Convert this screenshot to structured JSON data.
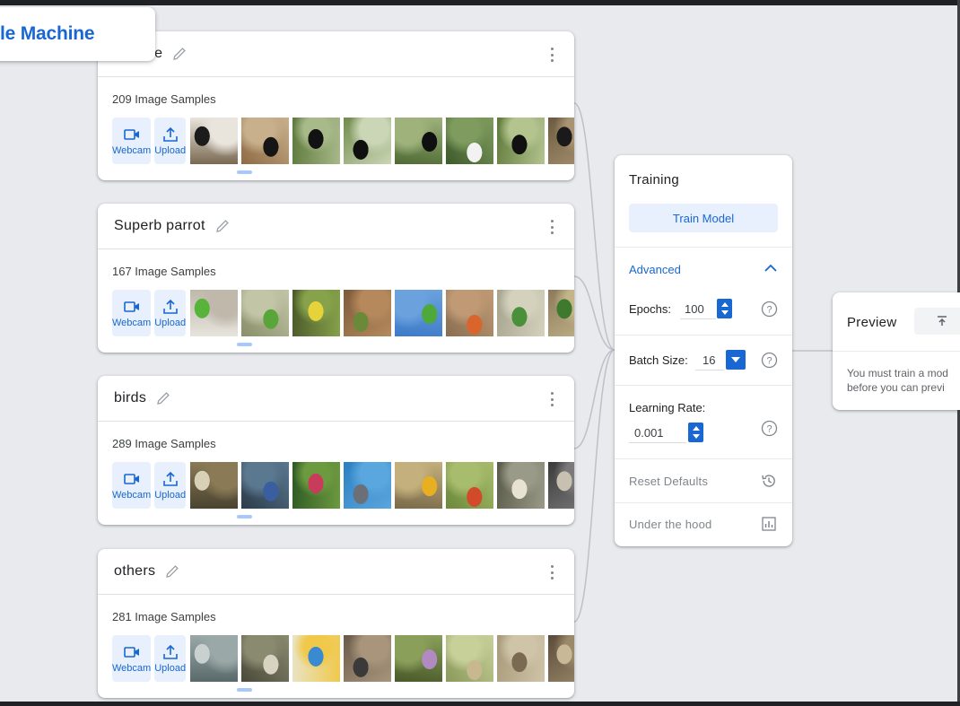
{
  "app": {
    "title_fragment": "le Machine"
  },
  "classes": [
    {
      "name": "Magpie",
      "sample_count": "209 Image Samples",
      "webcam_label": "Webcam",
      "upload_label": "Upload",
      "thumb_palettes": [
        [
          "#7a6a52",
          "#e9e4dc",
          "#1b1b1b"
        ],
        [
          "#8f6b45",
          "#c9b08d",
          "#151515"
        ],
        [
          "#5e7a3d",
          "#a8b98a",
          "#121212"
        ],
        [
          "#6f8a4a",
          "#cbd6b6",
          "#0f0f0f"
        ],
        [
          "#4f6b34",
          "#9fb27c",
          "#101010"
        ],
        [
          "#3d5a2b",
          "#7f9c5e",
          "#f2f2f2"
        ],
        [
          "#5f7a3a",
          "#b4c48f",
          "#111111"
        ],
        [
          "#6b5a3e",
          "#a89372",
          "#1a1a1a"
        ]
      ]
    },
    {
      "name": "Superb parrot",
      "sample_count": "167 Image Samples",
      "webcam_label": "Webcam",
      "upload_label": "Upload",
      "thumb_palettes": [
        [
          "#e6e3dc",
          "#bfb8ab",
          "#58b33a"
        ],
        [
          "#8a8f6a",
          "#c2c6a7",
          "#5aa53a"
        ],
        [
          "#4b5a2a",
          "#86a24a",
          "#e6d23a"
        ],
        [
          "#7c5a3a",
          "#b5895c",
          "#6a8a3a"
        ],
        [
          "#3e7bc8",
          "#6ba2de",
          "#4fa83a"
        ],
        [
          "#8a6e52",
          "#c09a74",
          "#d9652d"
        ],
        [
          "#a7a48e",
          "#d4d1bd",
          "#4a8f3a"
        ],
        [
          "#8a7a5a",
          "#c4b48a",
          "#3d7a2e"
        ]
      ]
    },
    {
      "name": "birds",
      "sample_count": "289 Image Samples",
      "webcam_label": "Webcam",
      "upload_label": "Upload",
      "thumb_palettes": [
        [
          "#4a4330",
          "#8a7a55",
          "#d9d0b8"
        ],
        [
          "#2c3c4a",
          "#5a7890",
          "#3a5fa0"
        ],
        [
          "#2f5a24",
          "#6c9a3f",
          "#c83b5a"
        ],
        [
          "#2a7fc0",
          "#5aa6de",
          "#6b6f78"
        ],
        [
          "#7a6a4a",
          "#c4b07c",
          "#e8b020"
        ],
        [
          "#6b8a3a",
          "#a7bc6c",
          "#d24a2a"
        ],
        [
          "#5a5a4a",
          "#9a9a88",
          "#e8e2d2"
        ],
        [
          "#3a3a3a",
          "#7a7a7a",
          "#c8c0b0"
        ]
      ]
    },
    {
      "name": "others",
      "sample_count": "281 Image Samples",
      "webcam_label": "Webcam",
      "upload_label": "Upload",
      "thumb_palettes": [
        [
          "#5a6a6a",
          "#9aa8a8",
          "#c8d0d0"
        ],
        [
          "#4a4a3a",
          "#8a8a70",
          "#d8d2c0"
        ],
        [
          "#e8e4c8",
          "#f0c84a",
          "#3a8ad0"
        ],
        [
          "#6a5a4a",
          "#a8957c",
          "#3a3a3a"
        ],
        [
          "#4a5a2a",
          "#8aa05a",
          "#b08ac0"
        ],
        [
          "#8a9a5a",
          "#c8d09a",
          "#c8b890"
        ],
        [
          "#a89a7a",
          "#d0c4a8",
          "#7a6a52"
        ],
        [
          "#5a4a3a",
          "#9a8a6a",
          "#c8b898"
        ]
      ]
    }
  ],
  "training": {
    "title": "Training",
    "train_button": "Train Model",
    "advanced_label": "Advanced",
    "epochs_label": "Epochs:",
    "epochs_value": "100",
    "batch_size_label": "Batch Size:",
    "batch_size_value": "16",
    "learning_rate_label": "Learning Rate:",
    "learning_rate_value": "0.001",
    "reset_label": "Reset Defaults",
    "under_hood_label": "Under the hood"
  },
  "preview": {
    "title": "Preview",
    "message_line1": "You must train a mod",
    "message_line2": "before you can previ"
  },
  "colors": {
    "accent": "#1967d2",
    "accent_light": "#e8f0fe",
    "background": "#e8eaed",
    "connector": "#bdc1c6"
  }
}
